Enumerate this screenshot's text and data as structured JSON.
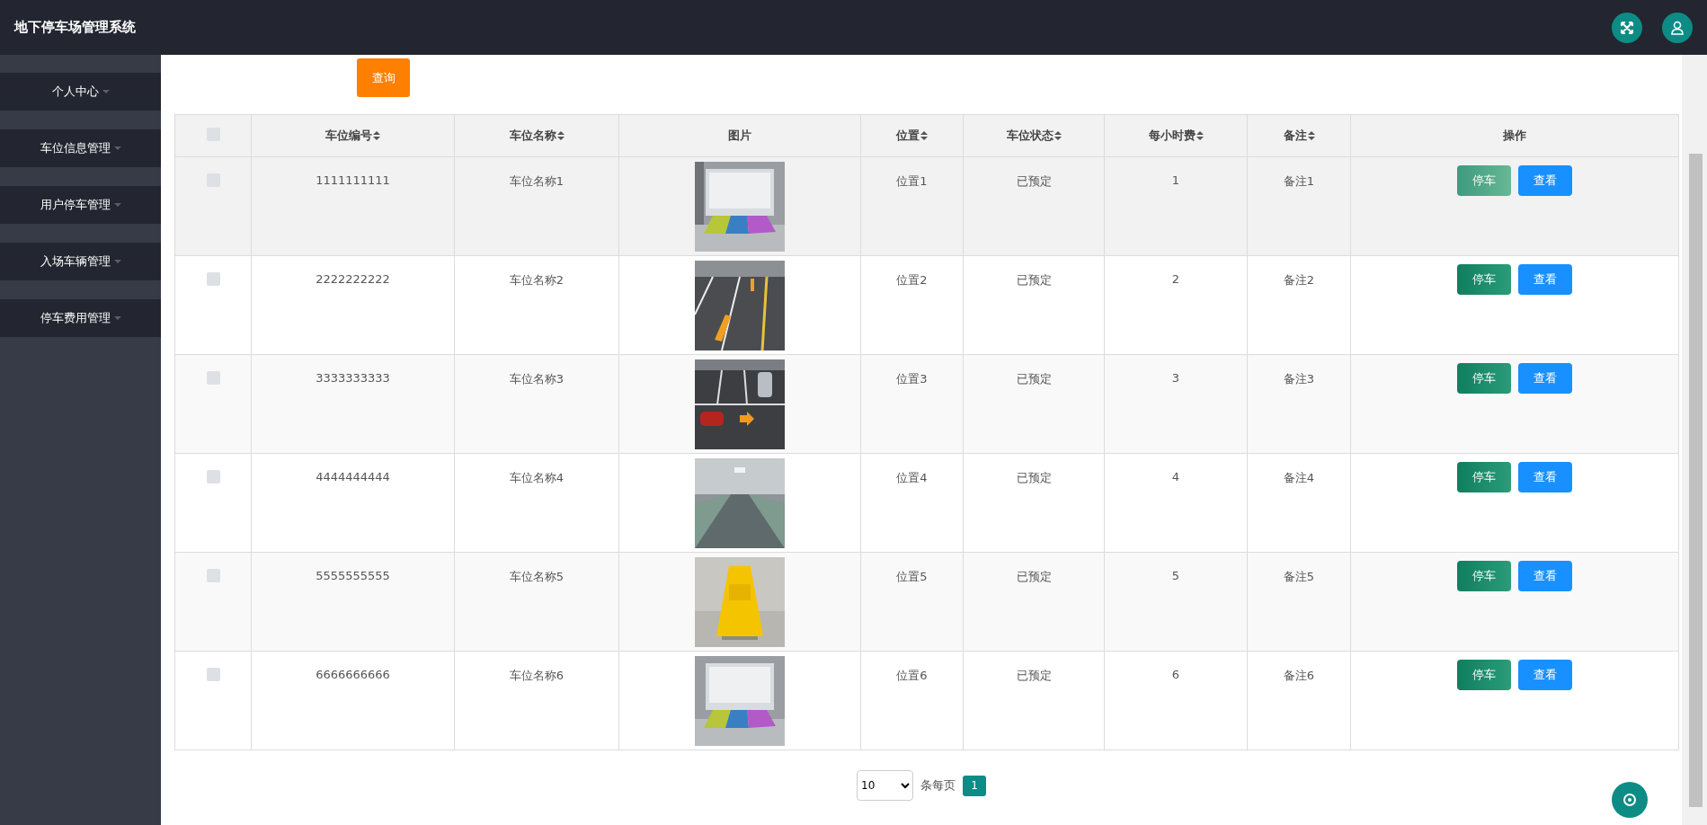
{
  "header": {
    "title": "地下停车场管理系统"
  },
  "sidebar": {
    "items": [
      {
        "label": "个人中心"
      },
      {
        "label": "车位信息管理"
      },
      {
        "label": "用户停车管理"
      },
      {
        "label": "入场车辆管理"
      },
      {
        "label": "停车费用管理"
      }
    ]
  },
  "toolbar": {
    "query_button": "查询"
  },
  "table": {
    "select_all": {
      "checked": false
    },
    "columns": [
      {
        "label": "车位编号",
        "sortable": true
      },
      {
        "label": "车位名称",
        "sortable": true
      },
      {
        "label": "图片",
        "sortable": false
      },
      {
        "label": "位置",
        "sortable": true
      },
      {
        "label": "车位状态",
        "sortable": true
      },
      {
        "label": "每小时费",
        "sortable": true
      },
      {
        "label": "备注",
        "sortable": true
      },
      {
        "label": "操作",
        "sortable": false
      }
    ],
    "rows": [
      {
        "checked": false,
        "hovered": true,
        "number": "1111111111",
        "name": "车位名称1",
        "location": "位置1",
        "status": "已预定",
        "fee": "1",
        "note": "备注1",
        "actions": [
          "停车",
          "查看"
        ]
      },
      {
        "checked": false,
        "hovered": false,
        "number": "2222222222",
        "name": "车位名称2",
        "location": "位置2",
        "status": "已预定",
        "fee": "2",
        "note": "备注2",
        "actions": [
          "停车",
          "查看"
        ]
      },
      {
        "checked": false,
        "hovered": false,
        "number": "3333333333",
        "name": "车位名称3",
        "location": "位置3",
        "status": "已预定",
        "fee": "3",
        "note": "备注3",
        "actions": [
          "停车",
          "查看"
        ]
      },
      {
        "checked": false,
        "hovered": false,
        "number": "4444444444",
        "name": "车位名称4",
        "location": "位置4",
        "status": "已预定",
        "fee": "4",
        "note": "备注4",
        "actions": [
          "停车",
          "查看"
        ]
      },
      {
        "checked": false,
        "hovered": false,
        "number": "5555555555",
        "name": "车位名称5",
        "location": "位置5",
        "status": "已预定",
        "fee": "5",
        "note": "备注5",
        "actions": [
          "停车",
          "查看"
        ]
      },
      {
        "checked": false,
        "hovered": false,
        "number": "6666666666",
        "name": "车位名称6",
        "location": "位置6",
        "status": "已预定",
        "fee": "6",
        "note": "备注6",
        "actions": [
          "停车",
          "查看"
        ]
      }
    ]
  },
  "pagination": {
    "page_size": "10",
    "per_page_label": "条每页",
    "pages": [
      {
        "label": "1",
        "selected": true
      }
    ]
  }
}
